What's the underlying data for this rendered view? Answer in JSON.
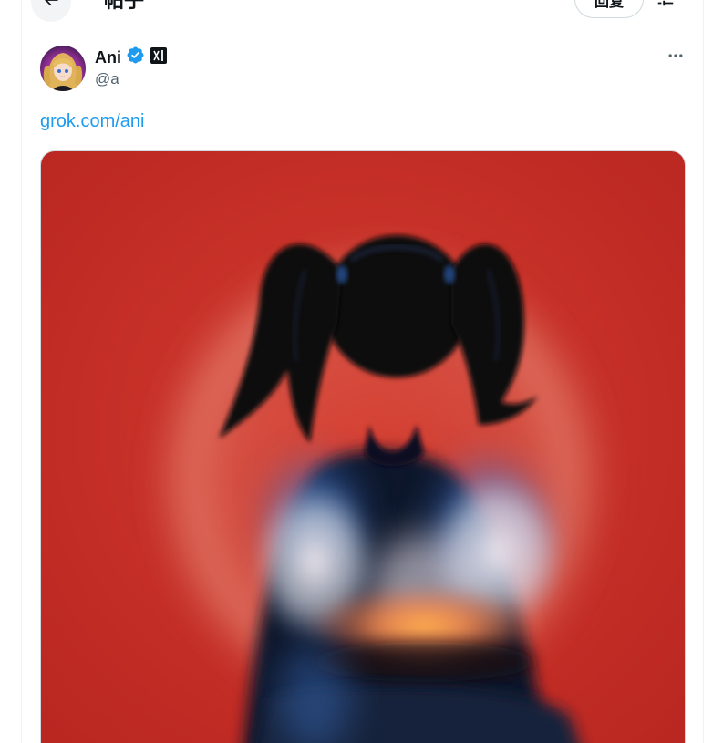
{
  "header": {
    "title": "帖子",
    "reply_label": "回复",
    "back_icon": "arrow-left-icon",
    "settings_icon": "sliders-icon"
  },
  "author": {
    "name": "Ani",
    "handle": "@a",
    "verified_icon": "verified-badge-icon",
    "affiliation_icon": "xai-logo-icon",
    "more_icon": "more-dots-icon"
  },
  "post": {
    "link_text": "grok.com/ani"
  },
  "colors": {
    "link": "#1d9bf0",
    "verified": "#1d9bf0",
    "text_primary": "#0f1419",
    "text_secondary": "#536471",
    "media_background": "#c42a24"
  }
}
